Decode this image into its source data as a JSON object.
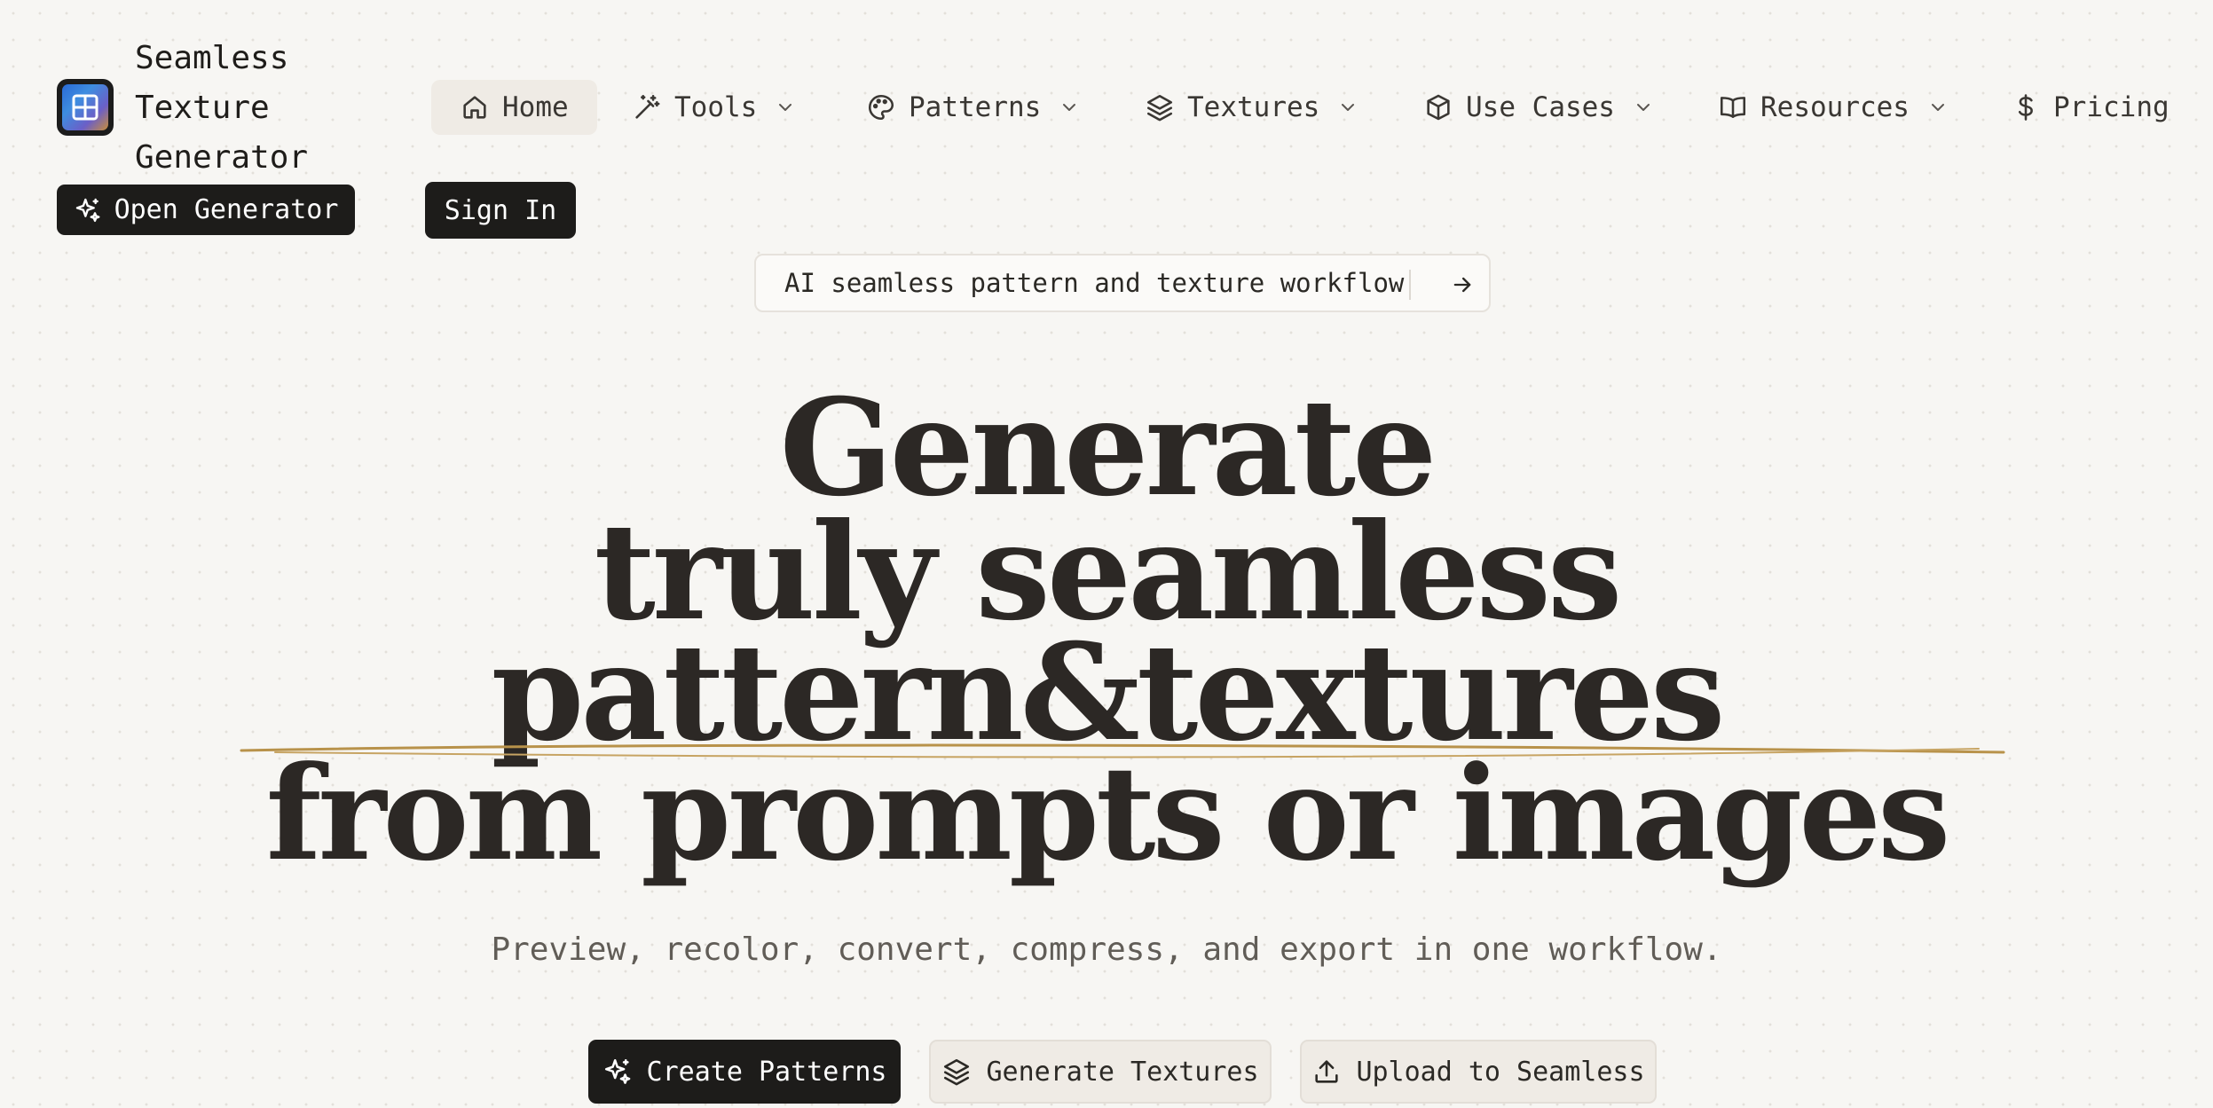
{
  "brand": {
    "name_lines": [
      "Seamless",
      "Texture",
      "Generator"
    ],
    "logo_icon": "grid-tile-logo"
  },
  "nav": {
    "items": [
      {
        "label": "Home",
        "icon": "home-icon",
        "active": true,
        "has_dropdown": false
      },
      {
        "label": "Tools",
        "icon": "magic-wand-icon",
        "active": false,
        "has_dropdown": true
      },
      {
        "label": "Patterns",
        "icon": "palette-icon",
        "active": false,
        "has_dropdown": true
      },
      {
        "label": "Textures",
        "icon": "layers-icon",
        "active": false,
        "has_dropdown": true
      },
      {
        "label": "Use Cases",
        "icon": "box-icon",
        "active": false,
        "has_dropdown": true
      },
      {
        "label": "Resources",
        "icon": "book-icon",
        "active": false,
        "has_dropdown": true
      },
      {
        "label": "Pricing",
        "icon": "dollar-icon",
        "active": false,
        "has_dropdown": false
      }
    ]
  },
  "header_actions": {
    "open_generator": "Open Generator",
    "sign_in": "Sign In"
  },
  "announcement": {
    "text": "AI seamless pattern and texture workflow",
    "arrow_icon": "arrow-right-icon"
  },
  "hero": {
    "lines": [
      "Generate",
      "truly seamless",
      "pattern&textures",
      "from prompts or images"
    ],
    "subtitle": "Preview, recolor, convert, compress, and export in one workflow."
  },
  "cta": {
    "create_patterns": "Create Patterns",
    "generate_textures": "Generate Textures",
    "upload": "Upload to Seamless"
  },
  "colors": {
    "background": "#f7f6f3",
    "text": "#262421",
    "dark_button": "#1d1c1a",
    "accent_underline": "#b8924a",
    "muted_text": "#615d57"
  }
}
